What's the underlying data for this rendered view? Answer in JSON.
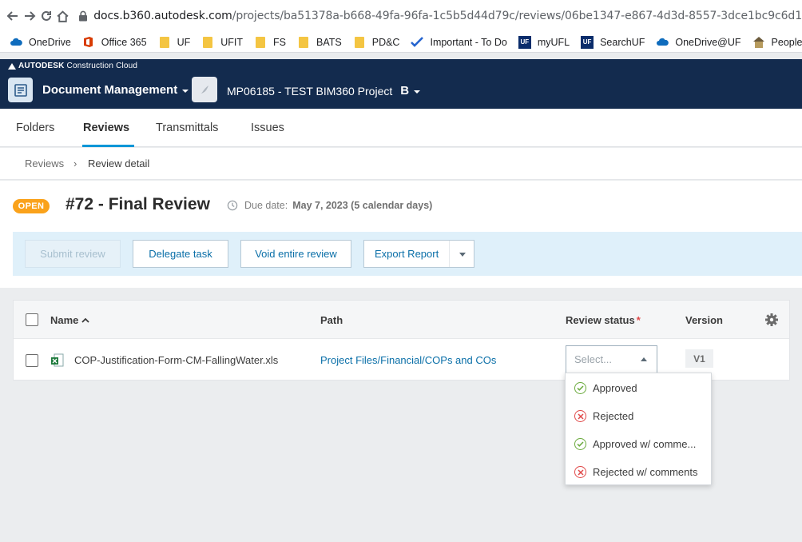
{
  "browser": {
    "url_host": "docs.b360.autodesk.com",
    "url_path": "/projects/ba51378a-b668-49fa-96fa-1c5b5d44d79c/reviews/06be1347-e867-4d3d-8557-3dce1bc9c6d1",
    "bookmarks": [
      {
        "label": "OneDrive",
        "icon": "onedrive-icon"
      },
      {
        "label": "Office 365",
        "icon": "office-icon"
      },
      {
        "label": "UF",
        "icon": "folder-icon"
      },
      {
        "label": "UFIT",
        "icon": "folder-icon"
      },
      {
        "label": "FS",
        "icon": "folder-icon"
      },
      {
        "label": "BATS",
        "icon": "folder-icon"
      },
      {
        "label": "PD&C",
        "icon": "folder-icon"
      },
      {
        "label": "Important - To Do",
        "icon": "todo-check-icon"
      },
      {
        "label": "myUFL",
        "icon": "uf-logo-icon"
      },
      {
        "label": "SearchUF",
        "icon": "uf-logo-icon"
      },
      {
        "label": "OneDrive@UF",
        "icon": "onedrive-icon"
      },
      {
        "label": "People Fin",
        "icon": "people-icon"
      }
    ]
  },
  "app": {
    "brand_main": "AUTODESK",
    "brand_sub": "Construction Cloud",
    "module": "Document Management",
    "project": "MP06185 - TEST BIM360 Project",
    "project_badge": "B"
  },
  "tabs": [
    {
      "label": "Folders"
    },
    {
      "label": "Reviews"
    },
    {
      "label": "Transmittals"
    },
    {
      "label": "Issues"
    }
  ],
  "breadcrumb": {
    "parent": "Reviews",
    "separator": "›",
    "current": "Review detail"
  },
  "review": {
    "status": "OPEN",
    "title": "#72 - Final Review",
    "due_label": "Due date:",
    "due_value": "May 7, 2023 (5 calendar days)"
  },
  "actions": {
    "submit": "Submit review",
    "delegate": "Delegate task",
    "void": "Void entire review",
    "export": "Export Report"
  },
  "table": {
    "columns": {
      "name": "Name",
      "path": "Path",
      "status": "Review status",
      "required_mark": "*",
      "version": "Version"
    },
    "rows": [
      {
        "file": "COP-Justification-Form-CM-FallingWater.xls",
        "path": "Project Files/Financial/COPs and COs",
        "status_placeholder": "Select...",
        "version": "V1"
      }
    ]
  },
  "status_options": [
    {
      "label": "Approved",
      "kind": "approved"
    },
    {
      "label": "Rejected",
      "kind": "rejected"
    },
    {
      "label": "Approved w/ comme...",
      "kind": "approved"
    },
    {
      "label": "Rejected w/ comments",
      "kind": "rejected"
    }
  ],
  "colors": {
    "header_bg": "#132b4e",
    "accent": "#0696d7",
    "open_badge": "#faa21b",
    "approved": "#6aaa3c",
    "rejected": "#e04848"
  }
}
